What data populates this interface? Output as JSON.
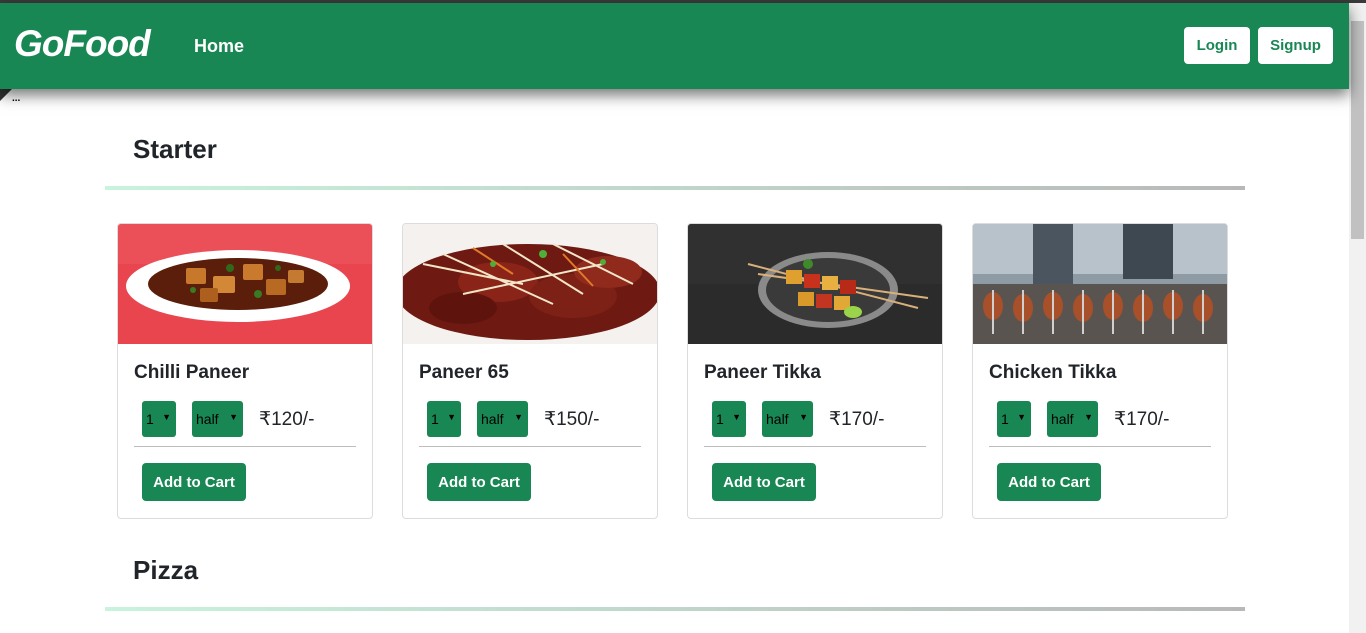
{
  "navbar": {
    "brand": "GoFood",
    "home_label": "Home",
    "login_label": "Login",
    "signup_label": "Signup"
  },
  "broken_image_alt": "...",
  "sections": [
    {
      "title": "Starter",
      "items": [
        {
          "name": "Chilli Paneer",
          "qty": "1",
          "size": "half",
          "price": "₹120/-",
          "button": "Add to Cart"
        },
        {
          "name": "Paneer 65",
          "qty": "1",
          "size": "half",
          "price": "₹150/-",
          "button": "Add to Cart"
        },
        {
          "name": "Paneer Tikka",
          "qty": "1",
          "size": "half",
          "price": "₹170/-",
          "button": "Add to Cart"
        },
        {
          "name": "Chicken Tikka",
          "qty": "1",
          "size": "half",
          "price": "₹170/-",
          "button": "Add to Cart"
        }
      ]
    },
    {
      "title": "Pizza",
      "items": []
    }
  ],
  "colors": {
    "brand_green": "#198754",
    "white": "#ffffff"
  }
}
